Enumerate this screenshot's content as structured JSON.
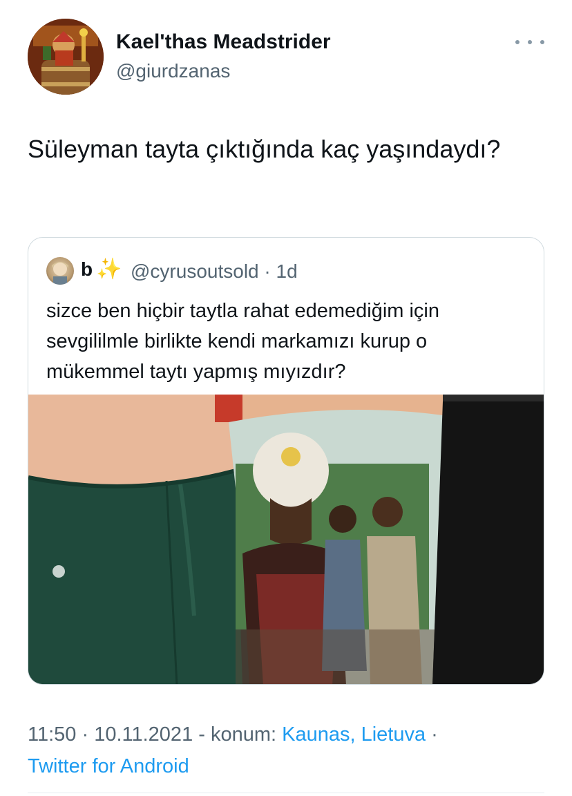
{
  "tweet": {
    "author": {
      "name": "Kael'thas Meadstrider",
      "handle": "@giurdzanas"
    },
    "text": "Süleyman tayta çıktığında kaç yaşındaydı?",
    "quoted": {
      "author_name": "b",
      "author_emoji": "✨",
      "handle_and_time": "@cyrusoutsold · 1d",
      "text": "sizce ben hiçbir taytla rahat edemediğim için sevgililmle birlikte kendi markamızı kurup o mükemmel taytı yapmış mıyızdır?"
    },
    "meta": {
      "time": "11:50",
      "sep1": " · ",
      "date": "10.11.2021",
      "location_prefix": " - konum: ",
      "location": "Kaunas, Lietuva",
      "sep2": " ·",
      "client": "Twitter for Android"
    }
  },
  "colors": {
    "link": "#1d9bf0",
    "secondary_text": "#536471",
    "border": "#cfd9de"
  }
}
